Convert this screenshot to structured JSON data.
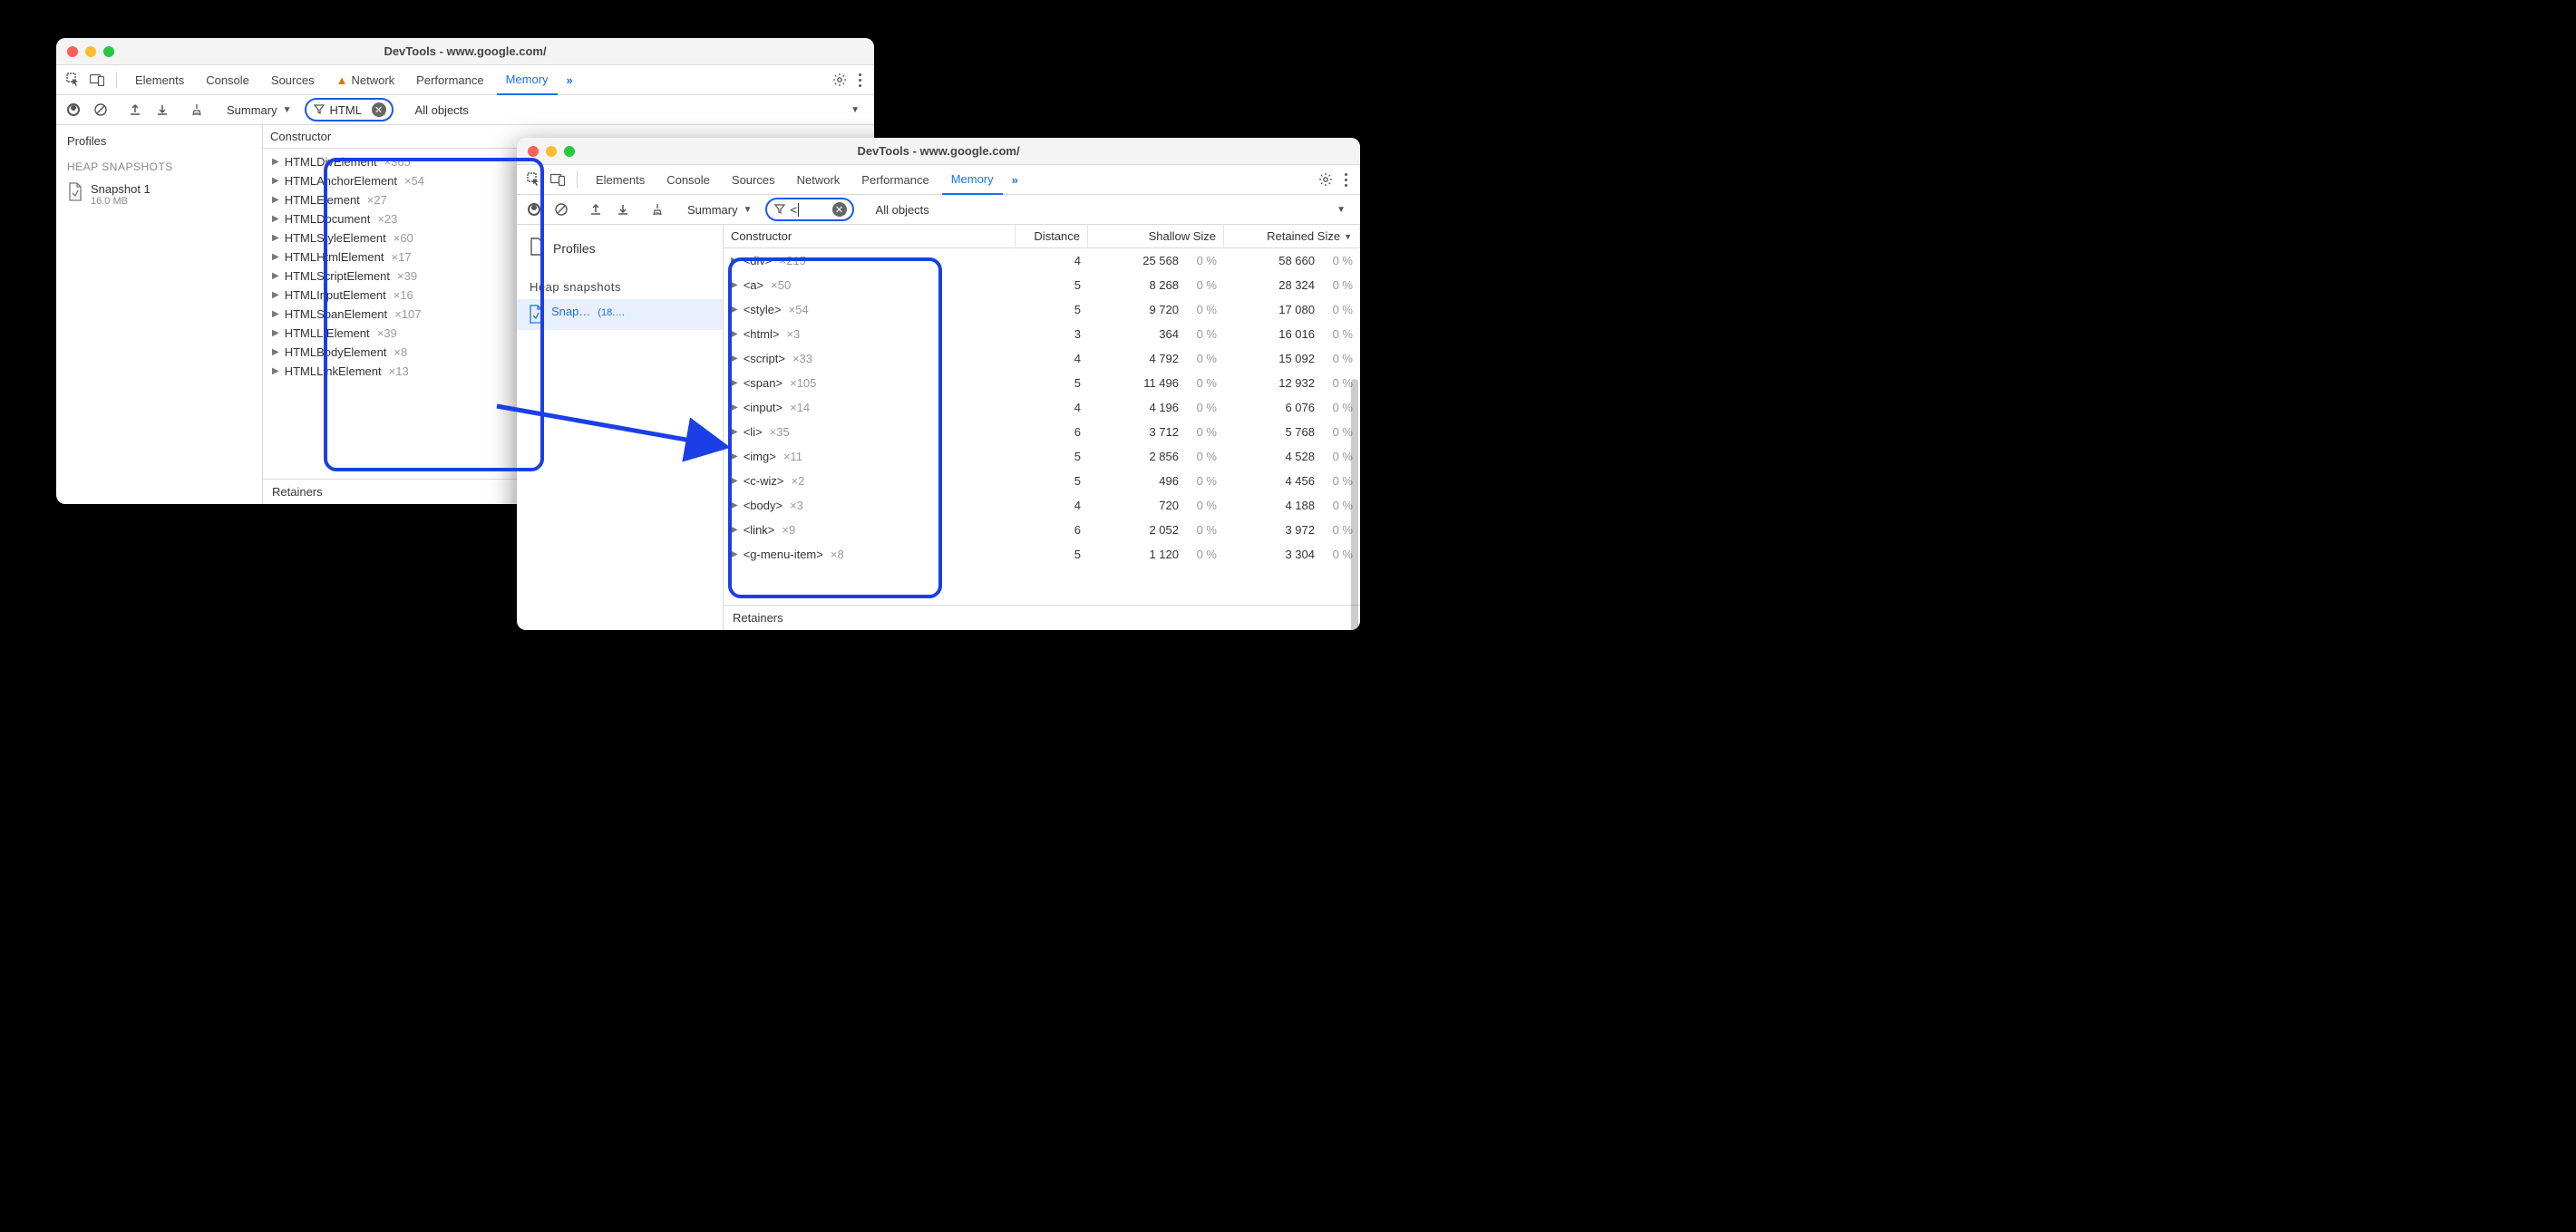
{
  "win1": {
    "title": "DevTools - www.google.com/",
    "tabs": [
      "Elements",
      "Console",
      "Sources",
      "Network",
      "Performance",
      "Memory"
    ],
    "active_tab": "Memory",
    "hasNetworkWarn": true,
    "summary_label": "Summary",
    "filter_value": "HTML",
    "all_objects_label": "All objects",
    "profiles_label": "Profiles",
    "heap_header": "HEAP SNAPSHOTS",
    "snapshot": {
      "name": "Snapshot 1",
      "size": "16.0 MB"
    },
    "constructor_header": "Constructor",
    "retainers_label": "Retainers",
    "constructors": [
      {
        "name": "HTMLDivElement",
        "count": "×365"
      },
      {
        "name": "HTMLAnchorElement",
        "count": "×54"
      },
      {
        "name": "HTMLElement",
        "count": "×27"
      },
      {
        "name": "HTMLDocument",
        "count": "×23"
      },
      {
        "name": "HTMLStyleElement",
        "count": "×60"
      },
      {
        "name": "HTMLHtmlElement",
        "count": "×17"
      },
      {
        "name": "HTMLScriptElement",
        "count": "×39"
      },
      {
        "name": "HTMLInputElement",
        "count": "×16"
      },
      {
        "name": "HTMLSpanElement",
        "count": "×107"
      },
      {
        "name": "HTMLLIElement",
        "count": "×39"
      },
      {
        "name": "HTMLBodyElement",
        "count": "×8"
      },
      {
        "name": "HTMLLinkElement",
        "count": "×13"
      }
    ]
  },
  "win2": {
    "title": "DevTools - www.google.com/",
    "tabs": [
      "Elements",
      "Console",
      "Sources",
      "Network",
      "Performance",
      "Memory"
    ],
    "active_tab": "Memory",
    "summary_label": "Summary",
    "filter_value": "<",
    "all_objects_label": "All objects",
    "profiles_label": "Profiles",
    "heap_header": "Heap snapshots",
    "snapshot": {
      "name": "Snap…",
      "size": "(18.…"
    },
    "headers": {
      "constructor": "Constructor",
      "distance": "Distance",
      "shallow": "Shallow Size",
      "retained": "Retained Size"
    },
    "retainers_label": "Retainers",
    "rows": [
      {
        "tag": "<div>",
        "count": "×215",
        "distance": "4",
        "shallow": "25 568",
        "sp": "0 %",
        "retained": "58 660",
        "rp": "0 %"
      },
      {
        "tag": "<a>",
        "count": "×50",
        "distance": "5",
        "shallow": "8 268",
        "sp": "0 %",
        "retained": "28 324",
        "rp": "0 %"
      },
      {
        "tag": "<style>",
        "count": "×54",
        "distance": "5",
        "shallow": "9 720",
        "sp": "0 %",
        "retained": "17 080",
        "rp": "0 %"
      },
      {
        "tag": "<html>",
        "count": "×3",
        "distance": "3",
        "shallow": "364",
        "sp": "0 %",
        "retained": "16 016",
        "rp": "0 %"
      },
      {
        "tag": "<script>",
        "count": "×33",
        "distance": "4",
        "shallow": "4 792",
        "sp": "0 %",
        "retained": "15 092",
        "rp": "0 %"
      },
      {
        "tag": "<span>",
        "count": "×105",
        "distance": "5",
        "shallow": "11 496",
        "sp": "0 %",
        "retained": "12 932",
        "rp": "0 %"
      },
      {
        "tag": "<input>",
        "count": "×14",
        "distance": "4",
        "shallow": "4 196",
        "sp": "0 %",
        "retained": "6 076",
        "rp": "0 %"
      },
      {
        "tag": "<li>",
        "count": "×35",
        "distance": "6",
        "shallow": "3 712",
        "sp": "0 %",
        "retained": "5 768",
        "rp": "0 %"
      },
      {
        "tag": "<img>",
        "count": "×11",
        "distance": "5",
        "shallow": "2 856",
        "sp": "0 %",
        "retained": "4 528",
        "rp": "0 %"
      },
      {
        "tag": "<c-wiz>",
        "count": "×2",
        "distance": "5",
        "shallow": "496",
        "sp": "0 %",
        "retained": "4 456",
        "rp": "0 %"
      },
      {
        "tag": "<body>",
        "count": "×3",
        "distance": "4",
        "shallow": "720",
        "sp": "0 %",
        "retained": "4 188",
        "rp": "0 %"
      },
      {
        "tag": "<link>",
        "count": "×9",
        "distance": "6",
        "shallow": "2 052",
        "sp": "0 %",
        "retained": "3 972",
        "rp": "0 %"
      },
      {
        "tag": "<g-menu-item>",
        "count": "×8",
        "distance": "5",
        "shallow": "1 120",
        "sp": "0 %",
        "retained": "3 304",
        "rp": "0 %"
      }
    ]
  }
}
